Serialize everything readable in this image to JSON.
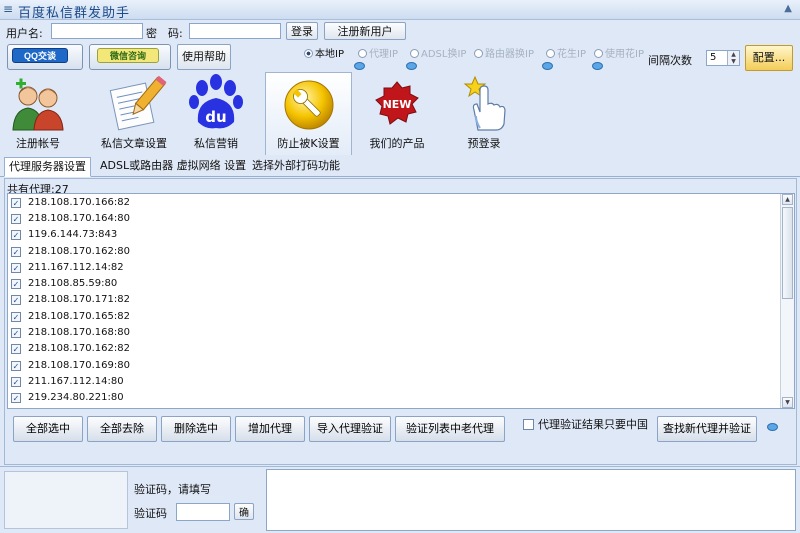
{
  "window": {
    "title": "百度私信群发助手"
  },
  "login": {
    "username_label": "用户名:",
    "username_value": "",
    "password_label": "密　码:",
    "password_value": "",
    "login_button": "登录",
    "register_button": "注册新用户"
  },
  "toolbar": {
    "qq_button": "QQ交谈",
    "wechat_button": "微信咨询",
    "help_button": "使用帮助",
    "radios": [
      {
        "label": "本地IP",
        "state": "selected"
      },
      {
        "label": "代理IP",
        "state": "disabled"
      },
      {
        "label": "ADSL换IP",
        "state": "disabled"
      },
      {
        "label": "路由器换IP",
        "state": "disabled"
      },
      {
        "label": "花生IP",
        "state": "disabled"
      },
      {
        "label": "使用花IP",
        "state": "disabled"
      }
    ],
    "interval_label": "间隔次数",
    "interval_value": "5",
    "config_button": "配置..."
  },
  "big_tools": [
    {
      "label": "注册帐号",
      "icon": "users-icon"
    },
    {
      "label": "私信文章设置",
      "icon": "pencil-document-icon"
    },
    {
      "label": "私信营销",
      "icon": "baidu-paw-icon"
    },
    {
      "label": "防止被K设置",
      "icon": "wrench-icon",
      "active": true
    },
    {
      "label": "我们的产品",
      "icon": "new-badge-icon"
    },
    {
      "label": "预登录",
      "icon": "pointer-hand-icon"
    }
  ],
  "tabs": [
    {
      "label": "代理服务器设置",
      "active": true
    },
    {
      "label": "ADSL或路由器 虚拟网络 设置"
    },
    {
      "label": "选择外部打码功能"
    }
  ],
  "proxy_panel": {
    "count_label": "共有代理:27",
    "proxies": [
      "218.108.170.166:82",
      "218.108.170.164:80",
      "119.6.144.73:843",
      "218.108.170.162:80",
      "211.167.112.14:82",
      "218.108.85.59:80",
      "218.108.170.171:82",
      "218.108.170.165:82",
      "218.108.170.168:80",
      "218.108.170.162:82",
      "218.108.170.169:80",
      "211.167.112.14:80",
      "219.234.80.221:80"
    ],
    "buttons": {
      "select_all": "全部选中",
      "deselect_all": "全部去除",
      "delete_selected": "删除选中",
      "add_proxy": "增加代理",
      "import_verify": "导入代理验证",
      "verify_old": "验证列表中老代理",
      "find_new": "查找新代理并验证"
    },
    "china_only_label": "代理验证结果只要中国"
  },
  "captcha": {
    "prompt": "验证码，请填写",
    "label": "验证码",
    "value": "",
    "confirm_button": "确"
  },
  "colors": {
    "accent": "#1c4a8a",
    "panel_bg": "#dfe8f6",
    "baidu_blue": "#2932e1",
    "new_red": "#c0161b",
    "wrench_yellow": "#f5c400"
  }
}
